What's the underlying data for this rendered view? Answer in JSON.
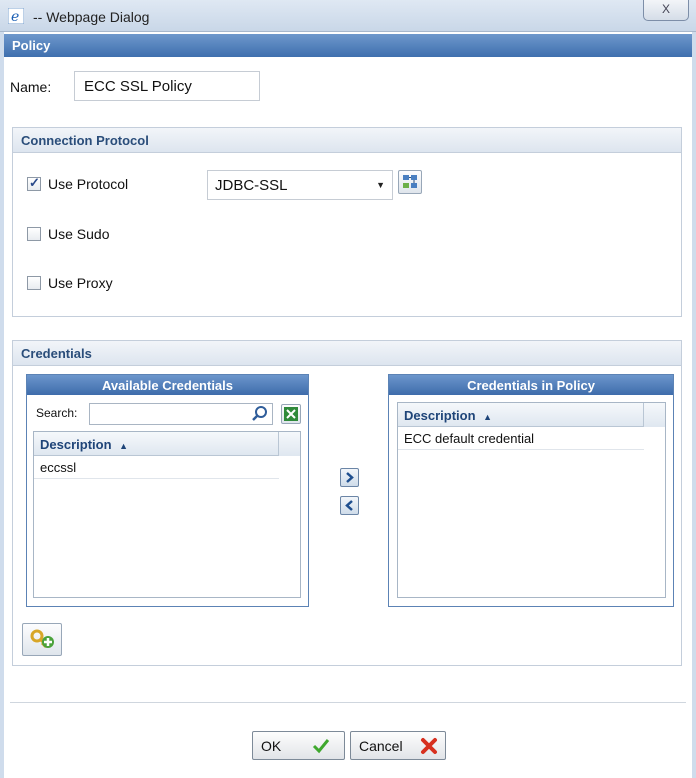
{
  "window": {
    "title": "-- Webpage Dialog",
    "close_glyph": "X"
  },
  "header": {
    "title": "Policy"
  },
  "name_field": {
    "label": "Name:",
    "value": "ECC SSL Policy"
  },
  "connection": {
    "title": "Connection Protocol",
    "use_protocol": {
      "label": "Use Protocol",
      "checked": true
    },
    "protocol_select": {
      "value": "JDBC-SSL"
    },
    "use_sudo": {
      "label": "Use Sudo",
      "checked": false
    },
    "use_proxy": {
      "label": "Use Proxy",
      "checked": false
    }
  },
  "credentials": {
    "title": "Credentials",
    "available": {
      "title": "Available Credentials",
      "search_label": "Search:",
      "search_value": "",
      "column": "Description",
      "sort_glyph": "▲",
      "rows": [
        "eccssl"
      ]
    },
    "in_policy": {
      "title": "Credentials in Policy",
      "column": "Description",
      "sort_glyph": "▲",
      "rows": [
        "ECC default credential"
      ]
    }
  },
  "footer": {
    "ok_label": "OK",
    "cancel_label": "Cancel"
  },
  "colors": {
    "header_blue": "#3f6fae",
    "ok_green": "#3fa82e",
    "cancel_red": "#d7301f"
  },
  "icons": [
    "ie-logo-icon",
    "close-icon",
    "checkbox-check-icon",
    "dropdown-arrow-icon",
    "add-protocol-icon",
    "magnifier-icon",
    "excel-export-icon",
    "sort-asc-icon",
    "move-right-icon",
    "move-left-icon",
    "add-credential-key-icon",
    "checkmark-icon",
    "x-icon"
  ]
}
